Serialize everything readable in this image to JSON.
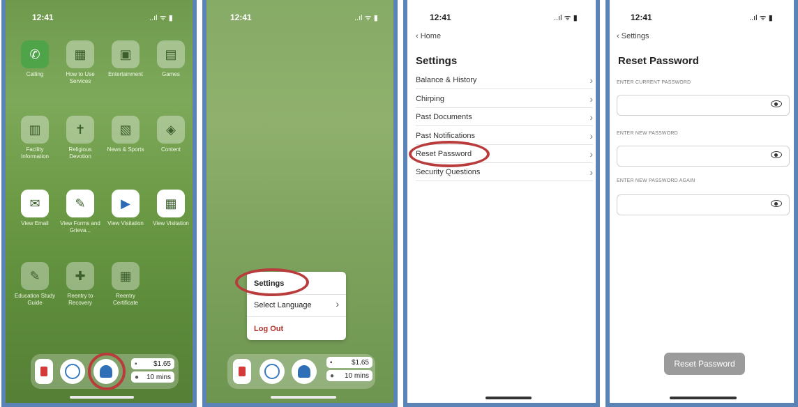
{
  "status": {
    "time": "12:41",
    "signal": "..ıl ᯤ ▮"
  },
  "home": {
    "apps": [
      {
        "label": "Calling",
        "icon": "phone-chat-icon"
      },
      {
        "label": "How to Use Services",
        "icon": "services-icon"
      },
      {
        "label": "Entertainment",
        "icon": "entertainment-icon"
      },
      {
        "label": "Games",
        "icon": "games-icon"
      },
      {
        "label": "Facility Information",
        "icon": "facility-icon"
      },
      {
        "label": "Religious Devotion",
        "icon": "religion-icon"
      },
      {
        "label": "News & Sports",
        "icon": "news-icon"
      },
      {
        "label": "Content",
        "icon": "content-icon"
      },
      {
        "label": "View Email",
        "icon": "email-icon"
      },
      {
        "label": "View Forms and Grieva...",
        "icon": "forms-icon"
      },
      {
        "label": "View Visitation",
        "icon": "visitation-icon"
      },
      {
        "label": "View Visitation",
        "icon": "calendar-icon"
      },
      {
        "label": "Education Study Guide",
        "icon": "education-icon"
      },
      {
        "label": "Reentry to Recovery",
        "icon": "puzzle-icon"
      },
      {
        "label": "Reentry Certificate",
        "icon": "certificate-icon"
      }
    ],
    "balance": "$1.65",
    "minutes": "10 mins"
  },
  "menu": {
    "settings": "Settings",
    "language": "Select Language",
    "logout": "Log Out"
  },
  "settings": {
    "back": "Home",
    "title": "Settings",
    "rows": [
      "Balance & History",
      "Chirping",
      "Past Documents",
      "Past Notifications",
      "Reset Password",
      "Security Questions"
    ]
  },
  "reset": {
    "back": "Settings",
    "title": "Reset Password",
    "current_label": "ENTER CURRENT PASSWORD",
    "new_label": "ENTER NEW PASSWORD",
    "again_label": "ENTER NEW PASSWORD AGAIN",
    "button": "Reset Password"
  },
  "colors": {
    "frame": "#5b83b6",
    "highlight": "#b93b3b",
    "logout": "#b2322b"
  }
}
